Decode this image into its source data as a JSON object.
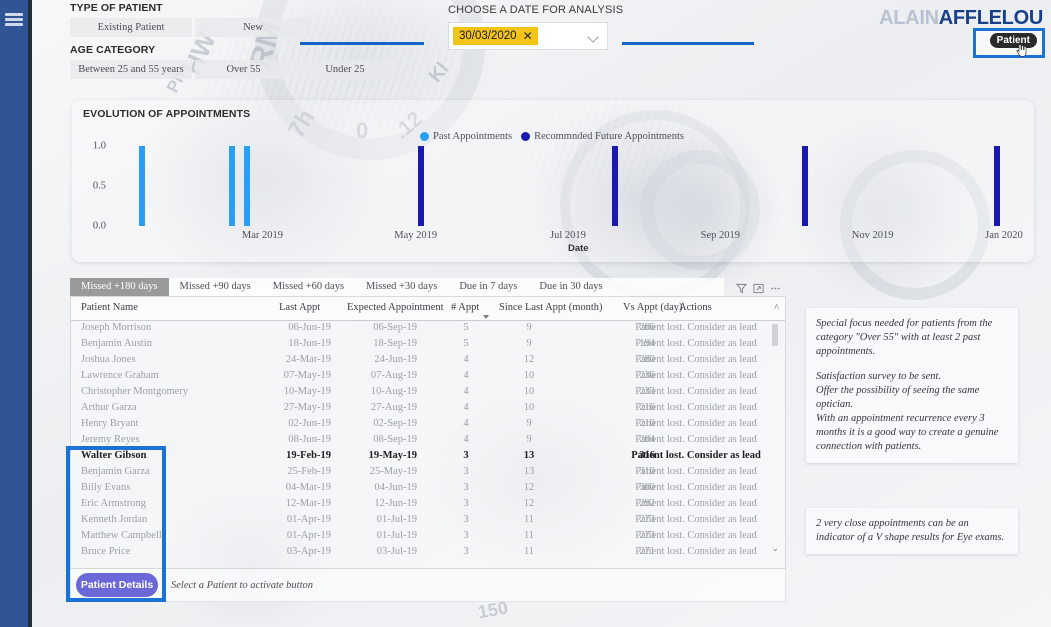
{
  "app": {
    "brand_light": "ALAIN",
    "brand_dark": "AFFLELOU",
    "tooltip": "Patient",
    "accent_blue": "#1a73d4",
    "highlight_yellow": "#f2c417",
    "past_color": "#2a9df4",
    "future_color": "#1a1ab0"
  },
  "sidebar": {
    "menu_icon": "hamburger-icon"
  },
  "filters": {
    "type_label": "TYPE OF PATIENT",
    "type_options": [
      "Existing Patient",
      "New"
    ],
    "age_label": "AGE CATEGORY",
    "age_options": [
      "Between 25 and 55 years",
      "Over 55",
      "Under 25"
    ]
  },
  "date_picker": {
    "label": "CHOOSE A DATE FOR ANALYSIS",
    "value": "30/03/2020",
    "clear_icon": "✕",
    "dropdown_icon": "chevron-down-icon"
  },
  "chart": {
    "title": "EVOLUTION OF APPOINTMENTS",
    "legend": [
      "Past Appointments",
      "Recommnded Future Appointments"
    ],
    "xaxis_title": "Date"
  },
  "chart_data": {
    "type": "bar",
    "title": "EVOLUTION OF APPOINTMENTS",
    "xlabel": "Date",
    "ylabel": "",
    "ylim": [
      0,
      1.0
    ],
    "yticks": [
      "0.0",
      "0.5",
      "1.0"
    ],
    "xticks": [
      "Mar 2019",
      "May 2019",
      "Jul 2019",
      "Sep 2019",
      "Nov 2019",
      "Jan 2020"
    ],
    "grid": false,
    "legend_position": "top-center",
    "series": [
      {
        "name": "Past Appointments",
        "color": "#2a9df4",
        "points": [
          {
            "x_frac": 0.03,
            "value": 1.0
          },
          {
            "x_frac": 0.128,
            "value": 1.0
          },
          {
            "x_frac": 0.145,
            "value": 1.0
          }
        ]
      },
      {
        "name": "Recommnded Future Appointments",
        "color": "#1a1ab0",
        "points": [
          {
            "x_frac": 0.335,
            "value": 1.0
          },
          {
            "x_frac": 0.548,
            "value": 1.0
          },
          {
            "x_frac": 0.757,
            "value": 1.0
          },
          {
            "x_frac": 0.967,
            "value": 1.0
          }
        ]
      }
    ]
  },
  "table": {
    "tabs": [
      "Missed +180 days",
      "Missed +90 days",
      "Missed +60 days",
      "Missed +30 days",
      "Due in 7 days",
      "Due in 30 days"
    ],
    "active_tab": "Missed +180 days",
    "icons": [
      "filter-icon",
      "focus-mode-icon",
      "more-options-icon"
    ],
    "columns": [
      "Patient Name",
      "Last Appt",
      "Expected Appointment",
      "# Appt",
      "Since Last Appt (month)",
      "Vs Appt (day)",
      "Actions"
    ],
    "rows": [
      {
        "name": "Joseph Morrison",
        "last": "06-Jun-19",
        "expected": "06-Sep-19",
        "appts": "5",
        "since": "9",
        "vs": "206",
        "action": "Patient lost. Consider as lead",
        "selected": false
      },
      {
        "name": "Benjamin Austin",
        "last": "18-Jun-19",
        "expected": "18-Sep-19",
        "appts": "5",
        "since": "9",
        "vs": "194",
        "action": "Patient lost. Consider as lead",
        "selected": false
      },
      {
        "name": "Joshua Jones",
        "last": "24-Mar-19",
        "expected": "24-Jun-19",
        "appts": "4",
        "since": "12",
        "vs": "280",
        "action": "Patient lost. Consider as lead",
        "selected": false
      },
      {
        "name": "Lawrence Graham",
        "last": "07-May-19",
        "expected": "07-Aug-19",
        "appts": "4",
        "since": "10",
        "vs": "236",
        "action": "Patient lost. Consider as lead",
        "selected": false
      },
      {
        "name": "Christopher Montgomery",
        "last": "10-May-19",
        "expected": "10-Aug-19",
        "appts": "4",
        "since": "10",
        "vs": "233",
        "action": "Patient lost. Consider as lead",
        "selected": false
      },
      {
        "name": "Arthur Garza",
        "last": "27-May-19",
        "expected": "27-Aug-19",
        "appts": "4",
        "since": "10",
        "vs": "216",
        "action": "Patient lost. Consider as lead",
        "selected": false
      },
      {
        "name": "Henry Bryant",
        "last": "02-Jun-19",
        "expected": "02-Sep-19",
        "appts": "4",
        "since": "9",
        "vs": "210",
        "action": "Patient lost. Consider as lead",
        "selected": false
      },
      {
        "name": "Jeremy Reyes",
        "last": "08-Jun-19",
        "expected": "08-Sep-19",
        "appts": "4",
        "since": "9",
        "vs": "204",
        "action": "Patient lost. Consider as lead",
        "selected": false
      },
      {
        "name": "Walter Gibson",
        "last": "19-Feb-19",
        "expected": "19-May-19",
        "appts": "3",
        "since": "13",
        "vs": "316",
        "action": "Patient lost. Consider as lead",
        "selected": true
      },
      {
        "name": "Benjamin Garza",
        "last": "25-Feb-19",
        "expected": "25-May-19",
        "appts": "3",
        "since": "13",
        "vs": "310",
        "action": "Patient lost. Consider as lead",
        "selected": false
      },
      {
        "name": "Billy Evans",
        "last": "04-Mar-19",
        "expected": "04-Jun-19",
        "appts": "3",
        "since": "12",
        "vs": "300",
        "action": "Patient lost. Consider as lead",
        "selected": false
      },
      {
        "name": "Eric Armstrong",
        "last": "12-Mar-19",
        "expected": "12-Jun-19",
        "appts": "3",
        "since": "12",
        "vs": "292",
        "action": "Patient lost. Consider as lead",
        "selected": false
      },
      {
        "name": "Kenneth Jordan",
        "last": "01-Apr-19",
        "expected": "01-Jul-19",
        "appts": "3",
        "since": "11",
        "vs": "273",
        "action": "Patient lost. Consider as lead",
        "selected": false
      },
      {
        "name": "Matthew Campbell",
        "last": "01-Apr-19",
        "expected": "01-Jul-19",
        "appts": "3",
        "since": "11",
        "vs": "273",
        "action": "Patient lost. Consider as lead",
        "selected": false
      },
      {
        "name": "Bruce Price",
        "last": "03-Apr-19",
        "expected": "03-Jul-19",
        "appts": "3",
        "since": "11",
        "vs": "271",
        "action": "Patient lost. Consider as lead",
        "selected": false
      }
    ]
  },
  "footer": {
    "button_label": "Patient Details",
    "hint": "Select a Patient to activate button"
  },
  "notes": [
    {
      "lines": [
        "Special focus needed for patients from the category \"Over 55\" with at least 2 past appointments.",
        "Satisfaction survey to be sent.",
        "Offer the possibility of seeing the same optician.",
        "With an appointment recurrence every 3 months it is a good way to create a genuine connection with patients."
      ]
    },
    {
      "lines": [
        "2 very close appointments can be an indicator of a V shape results for Eye exams."
      ]
    }
  ]
}
